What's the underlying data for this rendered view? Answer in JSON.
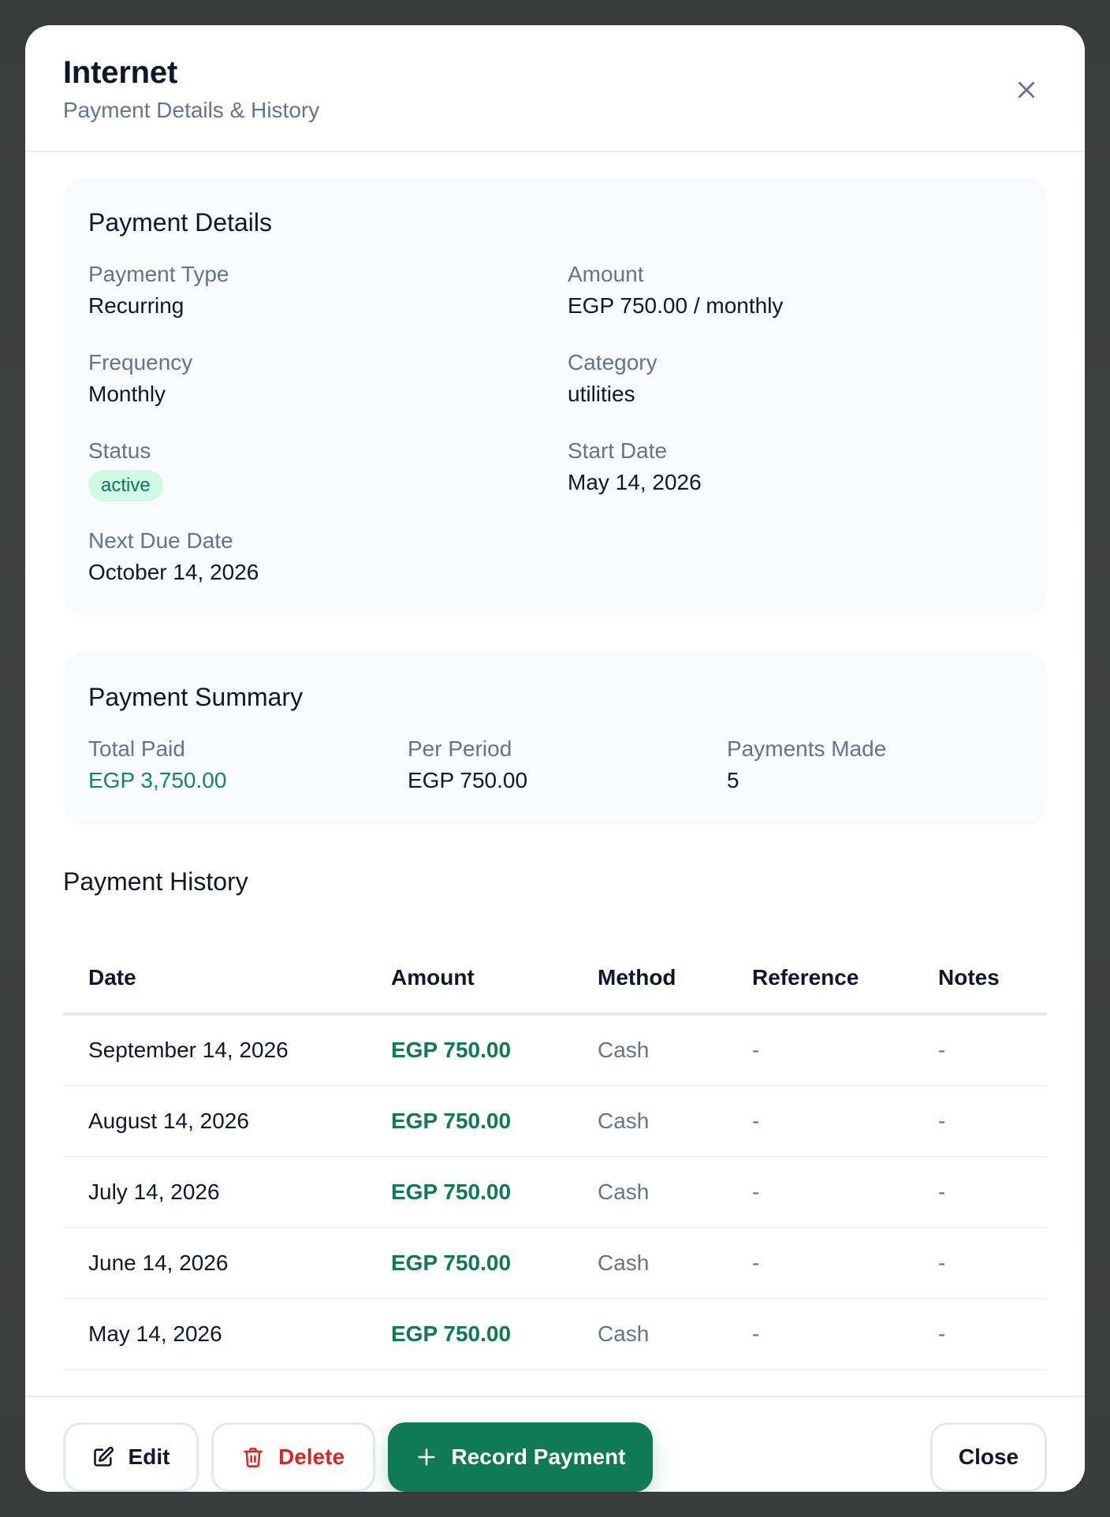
{
  "modal": {
    "title": "Internet",
    "subtitle": "Payment Details & History"
  },
  "details": {
    "heading": "Payment Details",
    "payment_type": {
      "label": "Payment Type",
      "value": "Recurring"
    },
    "amount": {
      "label": "Amount",
      "value": "EGP 750.00 / monthly"
    },
    "frequency": {
      "label": "Frequency",
      "value": "Monthly"
    },
    "category": {
      "label": "Category",
      "value": "utilities"
    },
    "status": {
      "label": "Status",
      "value": "active"
    },
    "start_date": {
      "label": "Start Date",
      "value": "May 14, 2026"
    },
    "next_due": {
      "label": "Next Due Date",
      "value": "October 14, 2026"
    }
  },
  "summary": {
    "heading": "Payment Summary",
    "total_paid": {
      "label": "Total Paid",
      "value": "EGP 3,750.00"
    },
    "per_period": {
      "label": "Per Period",
      "value": "EGP 750.00"
    },
    "payments_made": {
      "label": "Payments Made",
      "value": "5"
    }
  },
  "history": {
    "heading": "Payment History",
    "columns": [
      "Date",
      "Amount",
      "Method",
      "Reference",
      "Notes"
    ],
    "rows": [
      {
        "date": "September 14, 2026",
        "amount": "EGP 750.00",
        "method": "Cash",
        "reference": "-",
        "notes": "-"
      },
      {
        "date": "August 14, 2026",
        "amount": "EGP 750.00",
        "method": "Cash",
        "reference": "-",
        "notes": "-"
      },
      {
        "date": "July 14, 2026",
        "amount": "EGP 750.00",
        "method": "Cash",
        "reference": "-",
        "notes": "-"
      },
      {
        "date": "June 14, 2026",
        "amount": "EGP 750.00",
        "method": "Cash",
        "reference": "-",
        "notes": "-"
      },
      {
        "date": "May 14, 2026",
        "amount": "EGP 750.00",
        "method": "Cash",
        "reference": "-",
        "notes": "-"
      }
    ]
  },
  "footer": {
    "edit_label": "Edit",
    "delete_label": "Delete",
    "record_label": "Record Payment",
    "close_label": "Close"
  },
  "icons": {
    "close": "close-icon",
    "edit": "edit-icon",
    "delete": "trash-icon",
    "record": "plus-icon"
  },
  "colors": {
    "accent_green": "#0f7a55",
    "danger_red": "#dc2626",
    "badge_bg": "#d1fae5"
  }
}
